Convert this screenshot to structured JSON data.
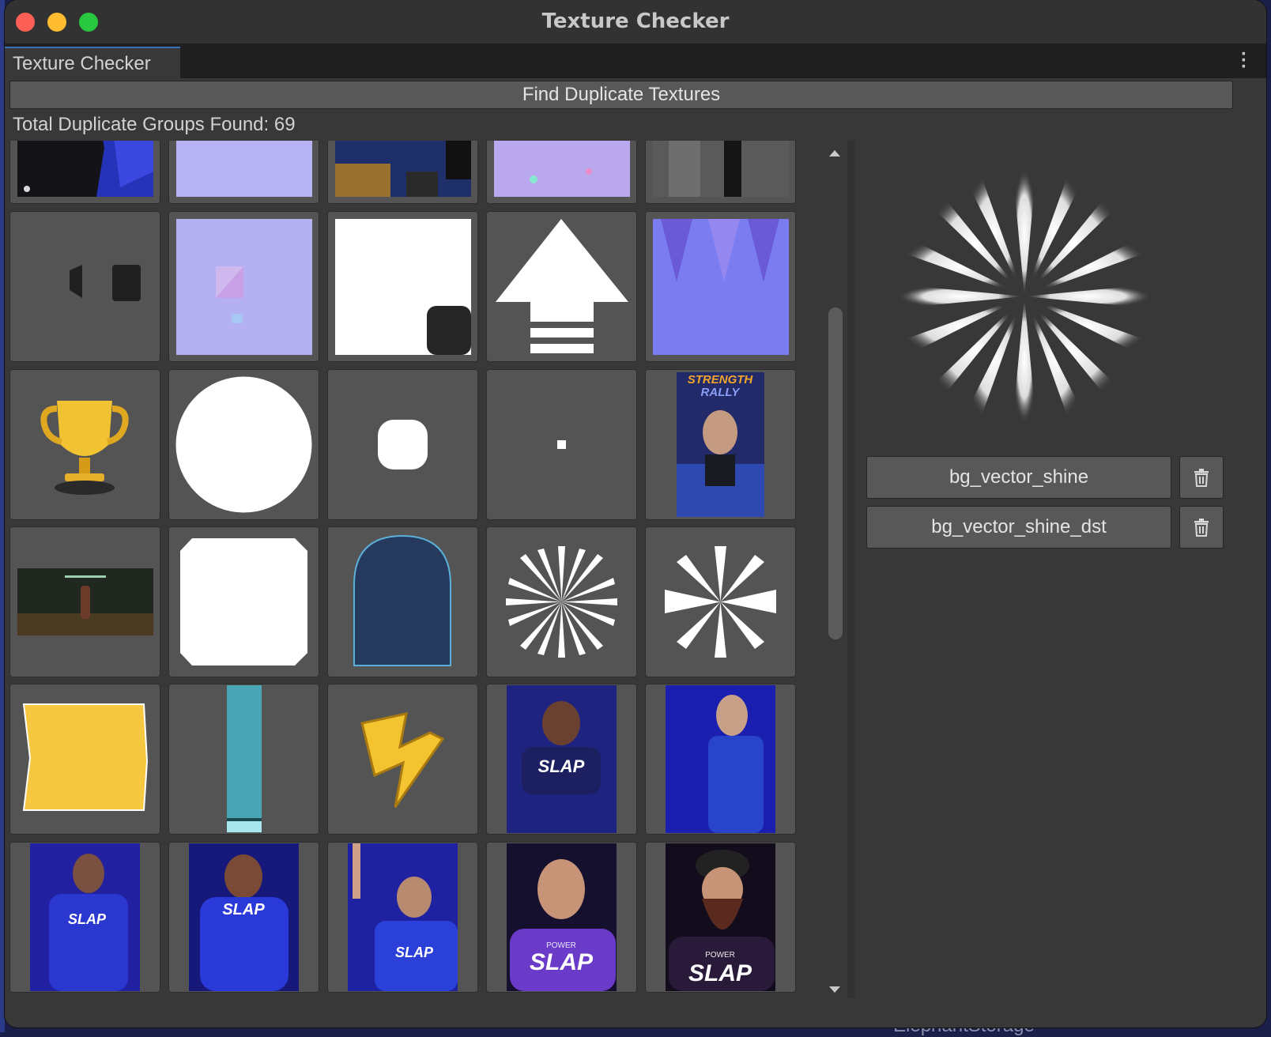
{
  "window": {
    "title": "Texture Checker"
  },
  "tabbar": {
    "active_tab": "Texture Checker"
  },
  "toolbar": {
    "find_label": "Find Duplicate Textures"
  },
  "summary": {
    "total_text": "Total Duplicate Groups Found: 69"
  },
  "background": {
    "bottom_text": "ElephantStorage"
  },
  "grid": {
    "columns": 5,
    "rows": [
      [
        "jersey-texture-thumbnail",
        "normal-map-light-thumbnail",
        "atlas-map-thumbnail",
        "normal-map-noise-thumbnail",
        "grey-metal-thumbnail"
      ],
      [
        "dark-blob-thumbnail",
        "normal-map-pattern-thumbnail",
        "white-square-thumbnail",
        "arrow-up-thumbnail",
        "normal-map-shirt-thumbnail"
      ],
      [
        "trophy-thumbnail",
        "white-circle-thumbnail",
        "rounded-square-thumbnail",
        "dot-thumbnail",
        "strength-rally-thumbnail"
      ],
      [
        "gym-room-thumbnail",
        "white-octagon-thumbnail",
        "arch-shape-thumbnail",
        "shine-burst-thumbnail",
        "shine-star-thumbnail"
      ],
      [
        "yellow-banner-thumbnail",
        "teal-bar-thumbnail",
        "lightning-icon-thumbnail",
        "athlete-photo-thumbnail",
        "athlete-photo-thumbnail"
      ],
      [
        "athlete-photo-thumbnail",
        "athlete-photo-thumbnail",
        "athlete-photo-thumbnail",
        "athlete-photo-thumbnail",
        "athlete-photo-thumbnail"
      ]
    ]
  },
  "details": {
    "selected_preview": "bg-vector-shine-preview",
    "items": [
      {
        "name": "bg_vector_shine",
        "delete_icon": "trash-icon"
      },
      {
        "name": "bg_vector_shine_dst",
        "delete_icon": "trash-icon"
      }
    ]
  },
  "thumbnail_texts": {
    "strength": "STRENGTH",
    "rally": "RALLY",
    "slap": "SLAP",
    "power": "POWER"
  },
  "colors": {
    "window_bg": "#383838",
    "title_bar": "#323232",
    "button_bg": "#585858",
    "cell_bg": "#545454",
    "tab_accent": "#3a72b8",
    "traffic_red": "#fe5f57",
    "traffic_yellow": "#febc2e",
    "traffic_green": "#28c840"
  }
}
